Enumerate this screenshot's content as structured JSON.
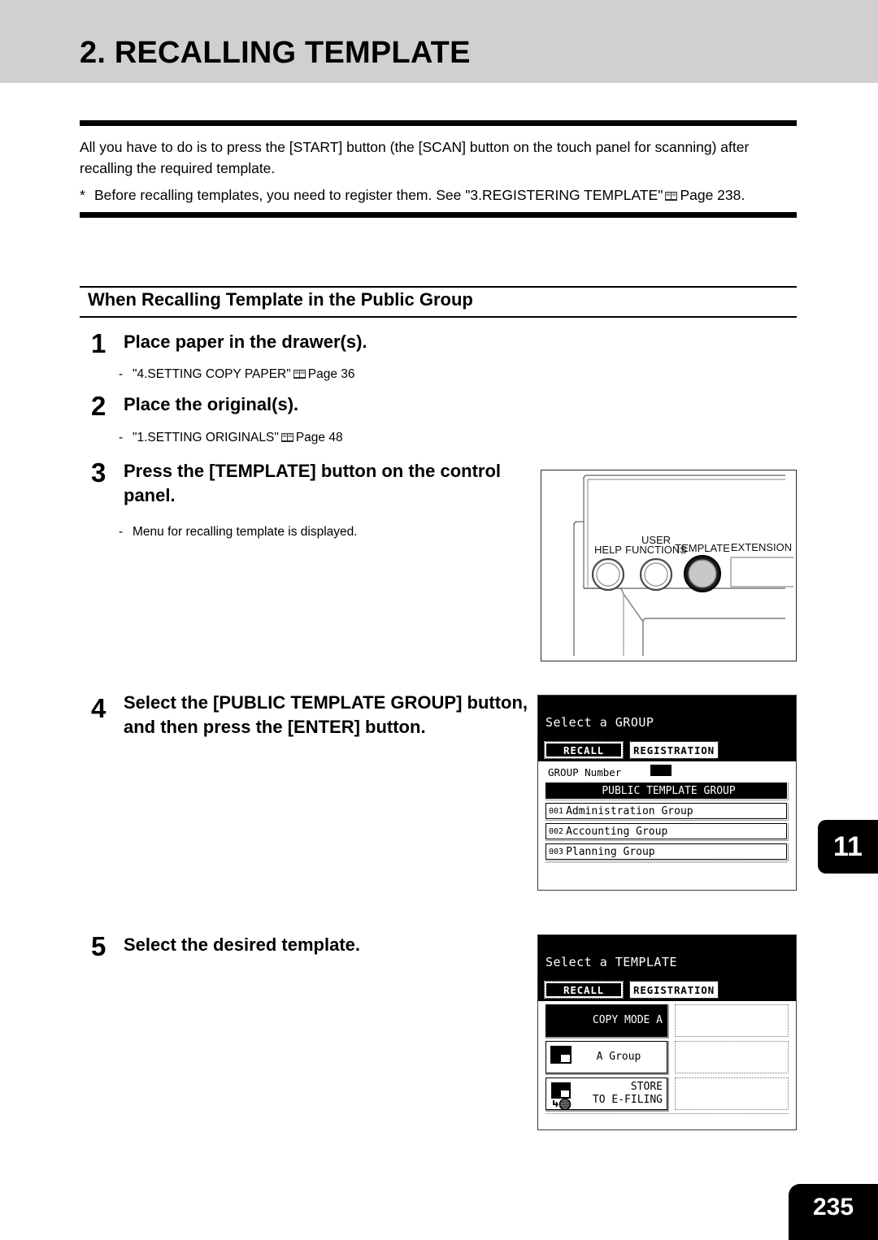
{
  "header": {
    "title": "2. RECALLING TEMPLATE"
  },
  "intro": {
    "paragraph": "All you have to do is to press the [START] button (the [SCAN] button on the touch panel for scanning) after recalling the required template.",
    "note_star": "*",
    "note_text_before": "Before recalling templates, you need to register them. See \"3.REGISTERING TEMPLATE\"",
    "note_text_after": "Page 238."
  },
  "section": {
    "title": "When Recalling Template in the Public Group"
  },
  "steps": [
    {
      "number": "1",
      "heading": "Place paper in the drawer(s).",
      "dash": "-",
      "sub_before": "\"4.SETTING COPY PAPER\"",
      "sub_after": "Page 36"
    },
    {
      "number": "2",
      "heading": "Place the original(s).",
      "dash": "-",
      "sub_before": "\"1.SETTING ORIGINALS\"",
      "sub_after": "Page 48"
    },
    {
      "number": "3",
      "heading": "Press the [TEMPLATE] button on the control panel.",
      "dash": "-",
      "sub_before": "Menu for recalling template is displayed.",
      "sub_after": ""
    },
    {
      "number": "4",
      "heading": "Select the [PUBLIC TEMPLATE GROUP] button, and then press the [ENTER] button."
    },
    {
      "number": "5",
      "heading": "Select the desired template."
    }
  ],
  "control_panel": {
    "labels": {
      "help": "HELP",
      "user_functions_line1": "USER",
      "user_functions_line2": "FUNCTIONS",
      "template": "TEMPLATE",
      "extension": "EXTENSION"
    }
  },
  "lcd_group": {
    "title": "Select a GROUP",
    "tabs": [
      {
        "label": "RECALL",
        "selected": true
      },
      {
        "label": "REGISTRATION",
        "selected": false
      }
    ],
    "group_number_label": "GROUP Number",
    "group_number_value": "",
    "items": [
      {
        "num": "",
        "label": "PUBLIC TEMPLATE GROUP",
        "selected": true
      },
      {
        "num": "001",
        "label": "Administration Group",
        "selected": false
      },
      {
        "num": "002",
        "label": "Accounting Group",
        "selected": false
      },
      {
        "num": "003",
        "label": "Planning Group",
        "selected": false
      }
    ]
  },
  "lcd_template": {
    "title": "Select a TEMPLATE",
    "tabs": [
      {
        "label": "RECALL",
        "selected": true
      },
      {
        "label": "REGISTRATION",
        "selected": false
      }
    ],
    "buttons": [
      {
        "line1": "COPY MODE A",
        "line2": "",
        "selected": true,
        "icon": "template-copy-icon"
      },
      {
        "line1": "A Group",
        "line2": "",
        "selected": false,
        "icon": "template-copy-icon"
      },
      {
        "line1": "STORE",
        "line2": "TO E-FILING",
        "selected": false,
        "icon": "template-efiling-icon"
      }
    ]
  },
  "side_tab": {
    "chapter": "11"
  },
  "footer": {
    "page_number": "235"
  },
  "colors": {
    "header_band": "#d0d0d0",
    "rule": "#000000",
    "lcd_bg": "#ffffff",
    "lcd_header": "#000000"
  }
}
